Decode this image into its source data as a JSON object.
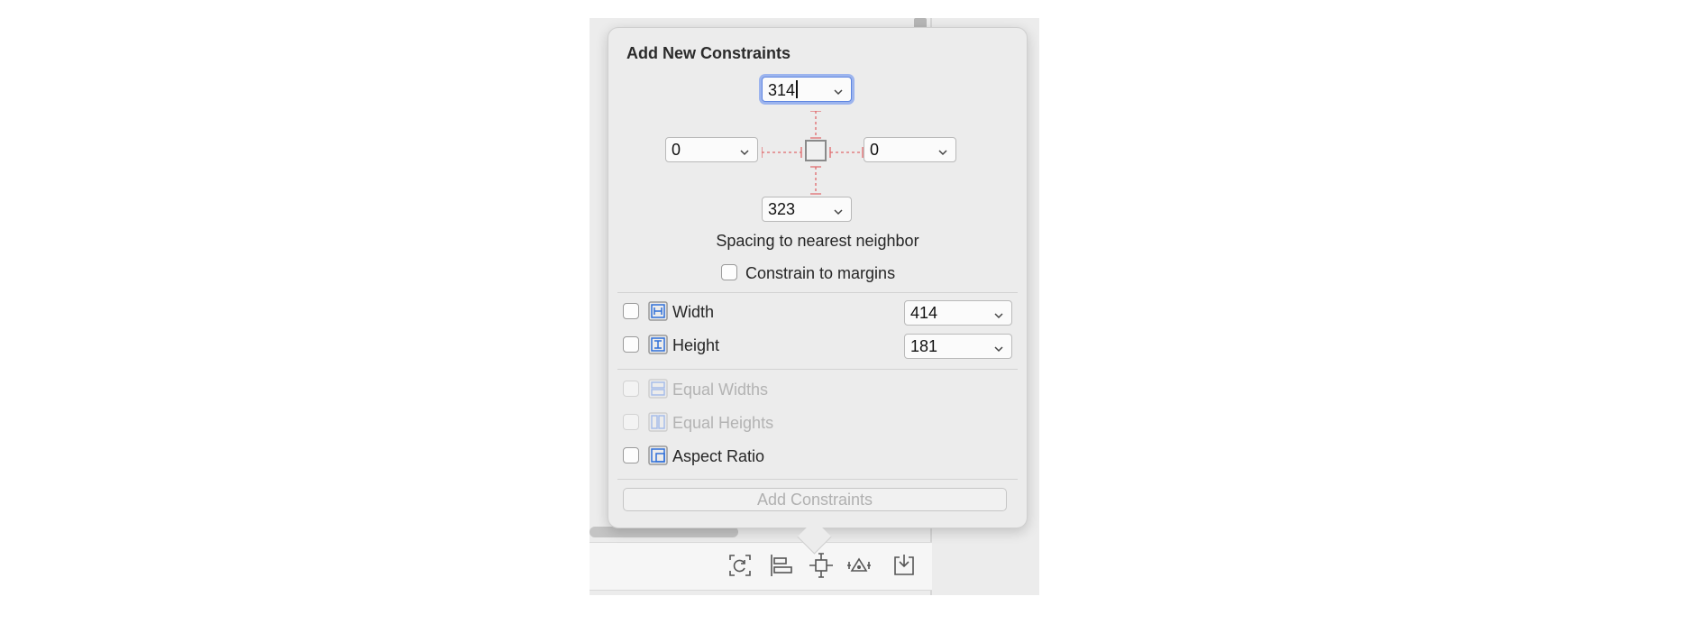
{
  "popover": {
    "title": "Add New Constraints",
    "spacing": {
      "top": "314",
      "left": "0",
      "right": "0",
      "bottom": "323",
      "caption": "Spacing to nearest neighbor"
    },
    "constrain_to_margins": {
      "label": "Constrain to margins",
      "checked": false
    },
    "width": {
      "label": "Width",
      "value": "414",
      "checked": false,
      "icon": "width-constraint-icon"
    },
    "height": {
      "label": "Height",
      "value": "181",
      "checked": false,
      "icon": "height-constraint-icon"
    },
    "equal_widths": {
      "label": "Equal Widths",
      "enabled": false,
      "icon": "equal-widths-icon"
    },
    "equal_heights": {
      "label": "Equal Heights",
      "enabled": false,
      "icon": "equal-heights-icon"
    },
    "aspect_ratio": {
      "label": "Aspect Ratio",
      "checked": false,
      "icon": "aspect-ratio-icon"
    },
    "add_button": "Add Constraints"
  },
  "bottom_toolbar": {
    "icons": [
      "update-frames-icon",
      "align-icon",
      "add-constraints-icon",
      "resolve-issues-icon",
      "embed-in-icon"
    ]
  },
  "colors": {
    "accent": "#2f6fd8",
    "focus_ring": "#9cb4ee",
    "guide_red": "#e0696b"
  }
}
